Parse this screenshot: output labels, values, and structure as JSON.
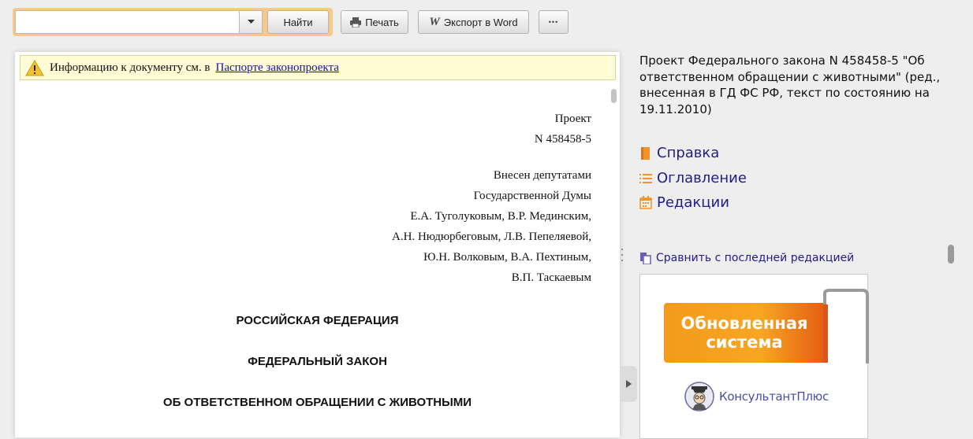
{
  "toolbar": {
    "search_value": "",
    "find_label": "Найти",
    "print_label": "Печать",
    "word_label": "Экспорт в Word",
    "more_label": "•••"
  },
  "info_bar": {
    "text": "Информацию к документу см. в",
    "link": "Паспорте законопроекта"
  },
  "document": {
    "lines_right": [
      "Проект",
      "N 458458-5",
      "Внесен депутатами",
      "Государственной Думы",
      "Е.А. Туголуковым, В.Р. Мединским,",
      "А.Н. Нюдюрбеговым, Л.В. Пепеляевой,",
      "Ю.Н. Волковым, В.А. Пехтиным,",
      "В.П. Таскаевым"
    ],
    "headings": [
      "РОССИЙСКАЯ ФЕДЕРАЦИЯ",
      "ФЕДЕРАЛЬНЫЙ ЗАКОН",
      "ОБ ОТВЕТСТВЕННОМ ОБРАЩЕНИИ С ЖИВОТНЫМИ"
    ]
  },
  "sidebar": {
    "doc_title": "Проект Федерального закона N 458458-5 \"Об ответственном обращении с животными\" (ред., внесенная в ГД ФС РФ, текст по состоянию на 19.11.2010)",
    "links": [
      {
        "label": "Справка",
        "icon": "book-icon"
      },
      {
        "label": "Оглавление",
        "icon": "list-icon"
      },
      {
        "label": "Редакции",
        "icon": "calendar-icon"
      }
    ],
    "compare_label": "Сравнить с последней редакцией",
    "banner": {
      "line1": "Обновленная",
      "line2": "система",
      "logo_text": "КонсультантПлюс"
    }
  },
  "colors": {
    "accent_orange": "#f6c98a",
    "link_blue": "#231a8c",
    "icon_orange": "#f0932b"
  }
}
